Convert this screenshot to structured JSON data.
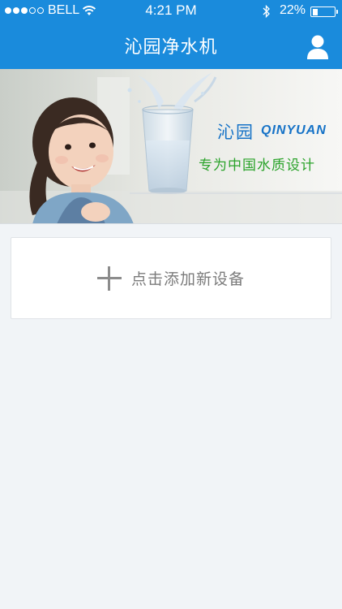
{
  "status_bar": {
    "signal_filled": 3,
    "signal_total": 5,
    "carrier": "BELL",
    "time": "4:21 PM",
    "battery_percent_text": "22%",
    "battery_level": 0.22
  },
  "nav": {
    "title": "沁园净水机",
    "profile_icon": "person-icon"
  },
  "banner": {
    "brand_cn": "沁园",
    "brand_en": "QINYUAN",
    "slogan": "专为中国水质设计",
    "brand_color": "#1572c7",
    "slogan_color": "#2ba32b"
  },
  "add_device": {
    "icon": "plus-icon",
    "label": "点击添加新设备"
  },
  "colors": {
    "accent": "#1a8bdc",
    "background": "#f1f4f7"
  }
}
